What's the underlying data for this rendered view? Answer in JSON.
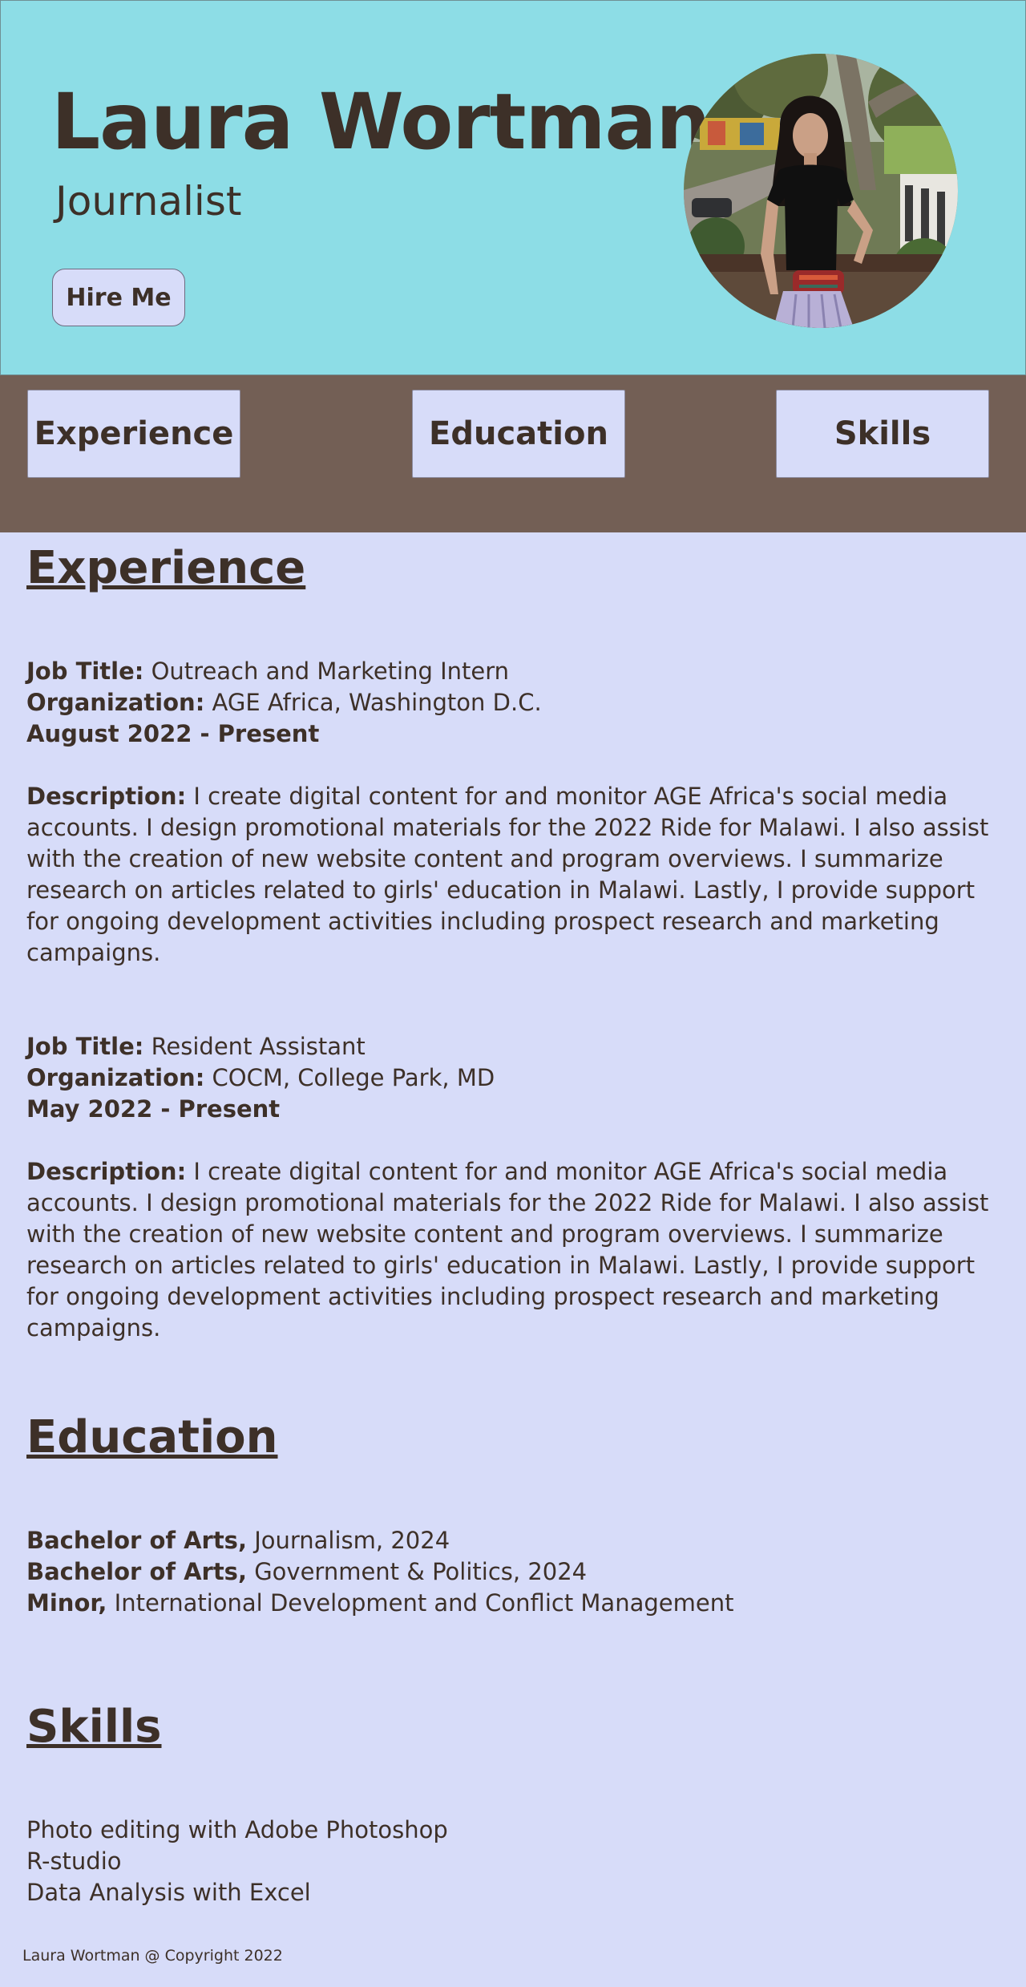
{
  "header": {
    "name": "Laura Wortman",
    "role": "Journalist",
    "hire_label": "Hire Me",
    "background_color": "#8ddde6"
  },
  "nav": {
    "experience_label": "Experience",
    "education_label": "Education",
    "skills_label": "Skills",
    "background_color": "#735f55"
  },
  "experience": {
    "title": "Experience",
    "jobs": [
      {
        "job_title_label": "Job Title:",
        "job_title": "Outreach and Marketing Intern",
        "org_label": "Organization:",
        "org": "AGE Africa, Washington D.C.",
        "dates": "August 2022 - Present",
        "desc_label": "Description:",
        "desc": "I create digital content for and monitor AGE Africa's social media accounts. I design promotional materials for the 2022 Ride for Malawi. I also assist with the creation of new website content and program overviews. I summarize research on articles related to girls' education in Malawi. Lastly, I provide support for ongoing development activities including prospect research and marketing campaigns."
      },
      {
        "job_title_label": "Job Title:",
        "job_title": "Resident Assistant",
        "org_label": "Organization:",
        "org": "COCM, College Park, MD",
        "dates": "May 2022 - Present",
        "desc_label": "Description:",
        "desc": "I create digital content for and monitor AGE Africa's social media accounts. I design promotional materials for the 2022 Ride for Malawi. I also assist with the creation of new website content and program overviews. I summarize research on articles related to girls' education in Malawi. Lastly, I provide support for ongoing development activities including prospect research and marketing campaigns."
      }
    ]
  },
  "education": {
    "title": "Education",
    "items": [
      {
        "label": "Bachelor of Arts,",
        "detail": "Journalism, 2024"
      },
      {
        "label": "Bachelor of Arts,",
        "detail": "Government & Politics, 2024"
      },
      {
        "label": "Minor,",
        "detail": "International Development and Conflict Management"
      }
    ]
  },
  "skills": {
    "title": "Skills",
    "items": [
      "Photo editing with Adobe Photoshop",
      "R-studio",
      "Data Analysis with Excel"
    ]
  },
  "footer": {
    "text": "Laura Wortman @ Copyright 2022"
  },
  "colors": {
    "page_background": "#d7dcf9",
    "text": "#3d3028"
  }
}
